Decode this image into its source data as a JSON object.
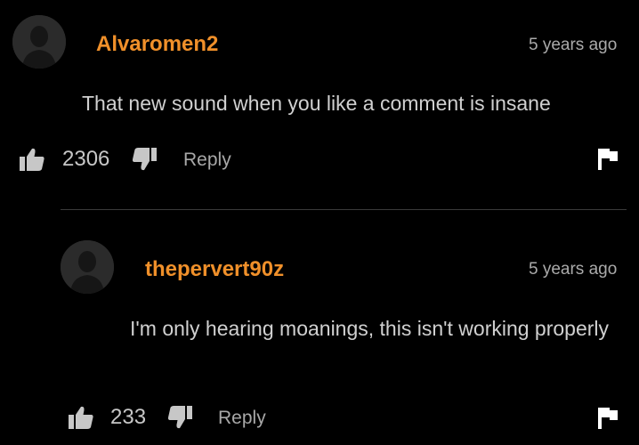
{
  "comments": [
    {
      "username": "Alvaromen2",
      "timestamp": "5 years ago",
      "text": "That new sound when you like a comment is insane",
      "likes": "2306",
      "reply_label": "Reply",
      "avatar_icon": "user-avatar-icon",
      "like_icon": "thumbs-up-icon",
      "dislike_icon": "thumbs-down-icon",
      "flag_icon": "flag-icon"
    },
    {
      "username": "thepervert90z",
      "timestamp": "5 years ago",
      "text": "I'm only hearing moanings, this isn't working properly",
      "likes": "233",
      "reply_label": "Reply",
      "avatar_icon": "user-avatar-icon",
      "like_icon": "thumbs-up-icon",
      "dislike_icon": "thumbs-down-icon",
      "flag_icon": "flag-icon"
    }
  ],
  "colors": {
    "background": "#000000",
    "username": "#f0902a",
    "text": "#d0d0d0",
    "muted": "#aaaaaa",
    "divider": "#3a3a3a"
  }
}
